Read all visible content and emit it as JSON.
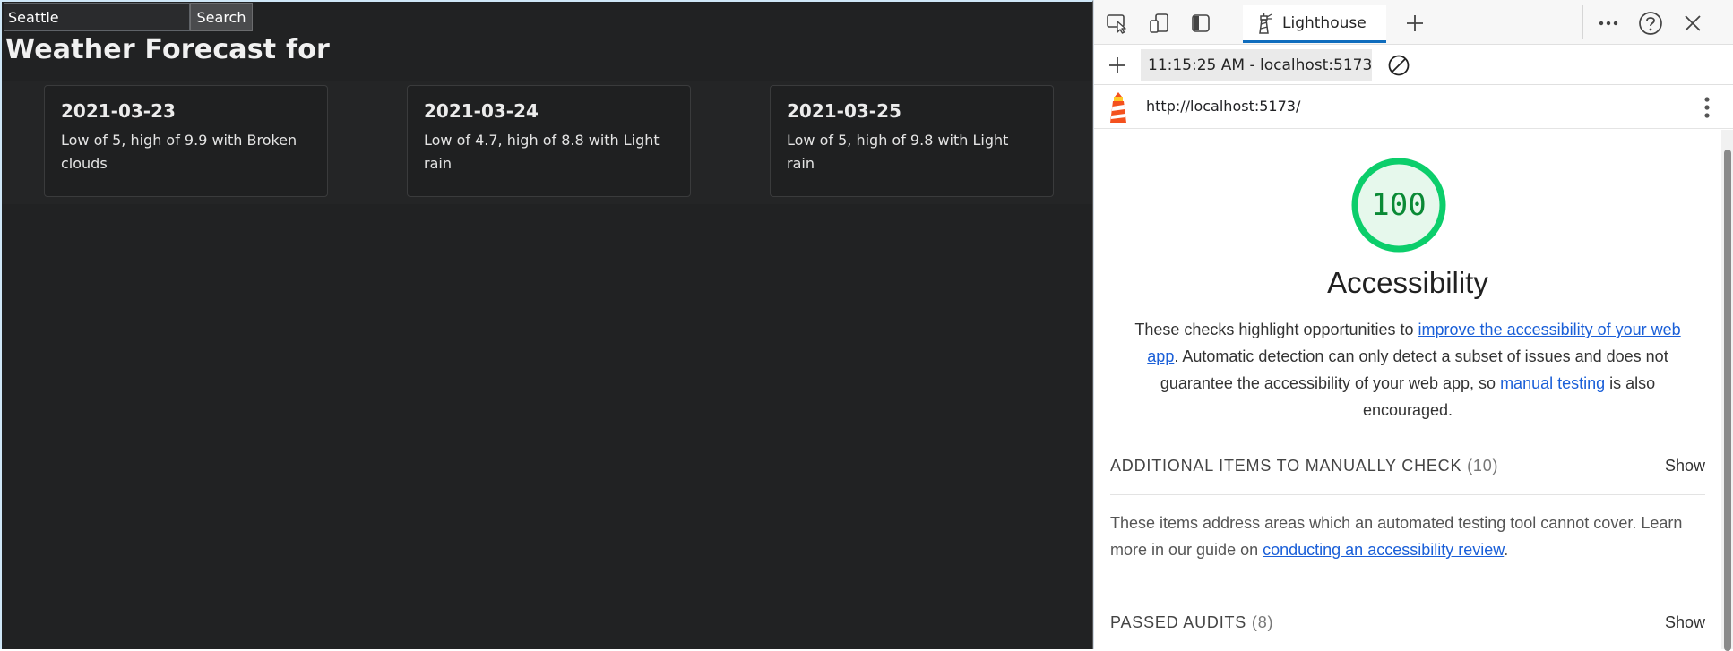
{
  "webpage": {
    "search": {
      "value": "Seattle",
      "button_label": "Search"
    },
    "title": "Weather Forecast for",
    "forecasts": [
      {
        "date": "2021-03-23",
        "summary": "Low of 5, high of 9.9 with Broken clouds"
      },
      {
        "date": "2021-03-24",
        "summary": "Low of 4.7, high of 8.8 with Light rain"
      },
      {
        "date": "2021-03-25",
        "summary": "Low of 5, high of 9.8 with Light rain"
      }
    ]
  },
  "devtools": {
    "active_tab": "Lighthouse",
    "report_select": "11:15:25 AM - localhost:5173",
    "url": "http://localhost:5173/",
    "report": {
      "score": "100",
      "category": "Accessibility",
      "description": {
        "part1": "These checks highlight opportunities to ",
        "link1": "improve the accessibility of your web app",
        "part2": ". Automatic detection can only detect a subset of issues and does not guarantee the accessibility of your web app, so ",
        "link2": "manual testing",
        "part3": " is also encouraged."
      },
      "manual_group": {
        "title": "ADDITIONAL ITEMS TO MANUALLY CHECK",
        "count": "(10)",
        "show_label": "Show",
        "description": "These items address areas which an automated testing tool cannot cover. Learn more in our guide on ",
        "link": "conducting an accessibility review",
        "description_end": "."
      },
      "passed_group": {
        "title": "PASSED AUDITS",
        "count": "(8)",
        "show_label": "Show"
      }
    },
    "colors": {
      "accent": "#0f6cbd",
      "score_pass": "#0cce6b",
      "link": "#1a5fd8"
    },
    "icons": [
      "inspect-element-icon",
      "device-emulation-icon",
      "dock-side-icon",
      "lighthouse-icon",
      "add-tab-icon",
      "more-tools-icon",
      "help-icon",
      "close-icon",
      "new-report-icon",
      "dropdown-caret-icon",
      "clear-icon",
      "lighthouse-logo-icon",
      "report-menu-icon"
    ]
  }
}
